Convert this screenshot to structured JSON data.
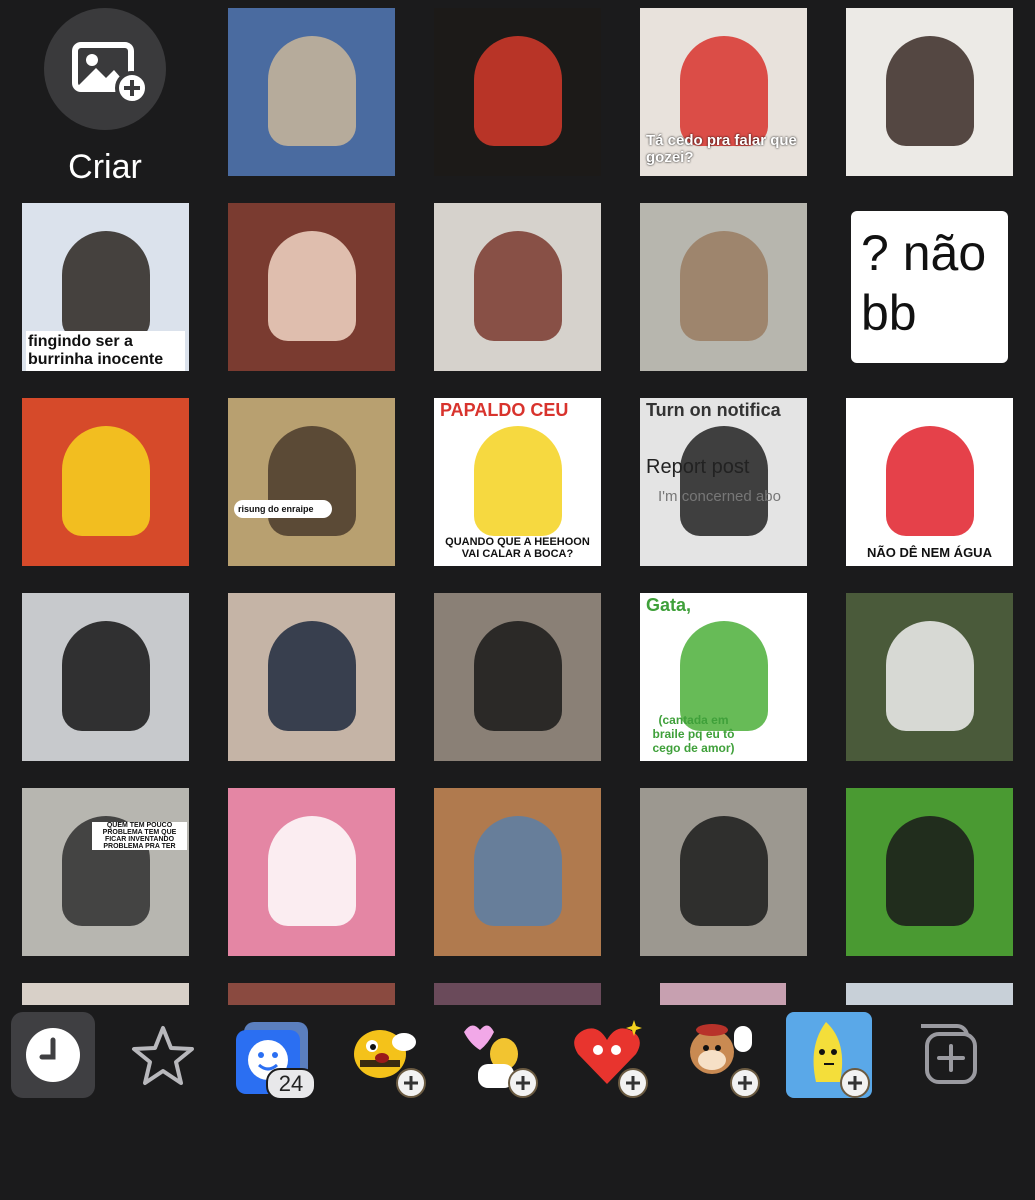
{
  "create": {
    "label": "Criar"
  },
  "stickers": [
    {
      "row": 0,
      "col": 1,
      "desc": "cat-fluffy-ears",
      "bg": "#4a6ba0",
      "fg": "#c9b69a",
      "caption": ""
    },
    {
      "row": 0,
      "col": 2,
      "desc": "knuckles-light",
      "bg": "#1c1a18",
      "fg": "#d43a2a",
      "caption": ""
    },
    {
      "row": 0,
      "col": 3,
      "desc": "red-hair-boy",
      "bg": "#e8e2dc",
      "fg": "#d8332d",
      "caption": "Tá cedo pra falar que gozei?"
    },
    {
      "row": 0,
      "col": 4,
      "desc": "boy-hand-face",
      "bg": "#eceae6",
      "fg": "#3a2a24",
      "caption": ""
    },
    {
      "row": 1,
      "col": 0,
      "desc": "boy-thinking",
      "bg": "#dbe2ec",
      "fg": "#2a2420",
      "caption": "fingindo ser a burrinha inocente"
    },
    {
      "row": 1,
      "col": 1,
      "desc": "smiling-boy",
      "bg": "#7a3b30",
      "fg": "#f1d6c4",
      "caption": ""
    },
    {
      "row": 1,
      "col": 2,
      "desc": "boy-facepalm",
      "bg": "#d6d2cc",
      "fg": "#7a3a2e",
      "caption": ""
    },
    {
      "row": 1,
      "col": 3,
      "desc": "rat-laughing-emoji",
      "bg": "#b7b6ae",
      "fg": "#9a7c62",
      "caption": ""
    },
    {
      "row": 1,
      "col": 4,
      "desc": "text-sticker",
      "bg": "#1b1b1c",
      "fg": "#ffffff",
      "caption": "? não bb"
    },
    {
      "row": 2,
      "col": 0,
      "desc": "emoji-flowers",
      "bg": "#d64a2a",
      "fg": "#f7d21e",
      "caption": ""
    },
    {
      "row": 2,
      "col": 1,
      "desc": "kratos-meme",
      "bg": "#b8a070",
      "fg": "#4a3b2c",
      "caption": "risung do enraipe"
    },
    {
      "row": 2,
      "col": 2,
      "desc": "pleading-emoji",
      "bg": "#ffffff",
      "fg": "#f4d21e",
      "caption_top": "PAPALDO CEU",
      "caption": "QUANDO QUE A HEEHOON VAI CALAR A BOCA?"
    },
    {
      "row": 2,
      "col": 3,
      "desc": "report-post",
      "bg": "#e4e4e4",
      "fg": "#222222",
      "caption_top": "Turn on notifica",
      "caption": "Report post",
      "caption_sub": "I'm concerned abo"
    },
    {
      "row": 2,
      "col": 4,
      "desc": "no-water-sign",
      "bg": "#ffffff",
      "fg": "#e0202a",
      "caption": "NÃO DÊ NEM ÁGUA"
    },
    {
      "row": 3,
      "col": 0,
      "desc": "boy-sunglasses",
      "bg": "#c7c9cc",
      "fg": "#151515",
      "caption": ""
    },
    {
      "row": 3,
      "col": 1,
      "desc": "boy-tongue",
      "bg": "#c5b4a6",
      "fg": "#1f2a3e",
      "caption": ""
    },
    {
      "row": 3,
      "col": 2,
      "desc": "boy-neck",
      "bg": "#8a8076",
      "fg": "#1a1a1a",
      "caption": ""
    },
    {
      "row": 3,
      "col": 3,
      "desc": "gata-braile",
      "bg": "#ffffff",
      "fg": "#4caf3a",
      "caption_top": "Gata,",
      "caption": "(cantada em braile pq eu tô cego de amor)"
    },
    {
      "row": 3,
      "col": 4,
      "desc": "dog-watering-can",
      "bg": "#4a5a3a",
      "fg": "#f0f0f0",
      "caption": ""
    },
    {
      "row": 4,
      "col": 0,
      "desc": "pilot-guy",
      "bg": "#b7b6b0",
      "fg": "#303030",
      "caption": "QUEM TEM POUCO PROBLEMA TEM QUE FICAR INVENTANDO PROBLEMA PRA TER"
    },
    {
      "row": 4,
      "col": 1,
      "desc": "snoopy",
      "bg": "#e486a4",
      "fg": "#ffffff",
      "caption": ""
    },
    {
      "row": 4,
      "col": 2,
      "desc": "zuckerberg-tongue",
      "bg": "#b07a4e",
      "fg": "#5a7fa8",
      "caption": ""
    },
    {
      "row": 4,
      "col": 3,
      "desc": "man-stage",
      "bg": "#9c9890",
      "fg": "#1c1c1c",
      "caption": ""
    },
    {
      "row": 4,
      "col": 4,
      "desc": "penguin-beard",
      "bg": "#4a9a32",
      "fg": "#1a1a1a",
      "caption": ""
    }
  ],
  "tabs": [
    {
      "name": "recent-tab",
      "icon": "clock-icon",
      "selected": true
    },
    {
      "name": "favorites-tab",
      "icon": "star-icon",
      "selected": false
    },
    {
      "name": "my-stickers-tab",
      "icon": "face-stack-icon",
      "badge": "24",
      "selected": false
    },
    {
      "name": "bee-pack-tab",
      "icon": "bee-icon",
      "selected": false
    },
    {
      "name": "trumpet-pack-tab",
      "icon": "trumpet-icon",
      "selected": false
    },
    {
      "name": "heart-pack-tab",
      "icon": "heart-icon",
      "selected": false
    },
    {
      "name": "dog-pack-tab",
      "icon": "dog-icon",
      "selected": false
    },
    {
      "name": "banana-pack-tab",
      "icon": "banana-icon",
      "selected": false
    },
    {
      "name": "add-pack-tab",
      "icon": "add-sticker-icon",
      "selected": false
    }
  ],
  "colors": {
    "background": "#1b1b1c",
    "selected_tab": "#3f3f42",
    "create_circle": "#3a3a3c"
  }
}
